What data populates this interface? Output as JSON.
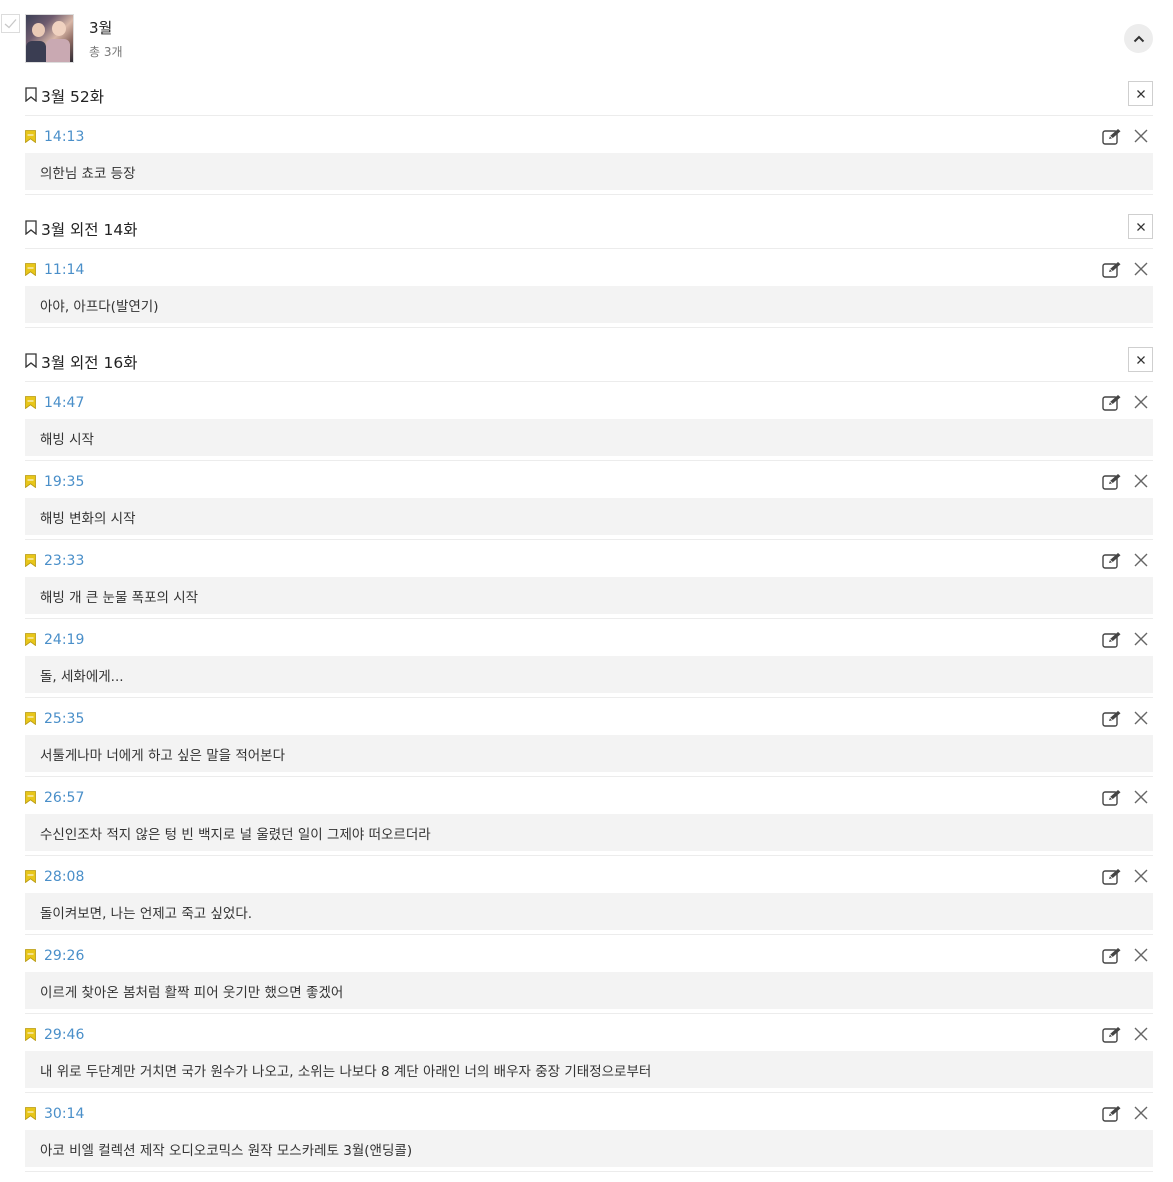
{
  "header": {
    "title": "3월",
    "count": "총 3개"
  },
  "episodes": [
    {
      "title": "3월 52화",
      "bookmarks": [
        {
          "time": "14:13",
          "note": "의한님 쵸코 등장"
        }
      ]
    },
    {
      "title": "3월 외전 14화",
      "bookmarks": [
        {
          "time": "11:14",
          "note": "아야, 아프다(발연기)"
        }
      ]
    },
    {
      "title": "3월 외전 16화",
      "bookmarks": [
        {
          "time": "14:47",
          "note": "해빙 시작"
        },
        {
          "time": "19:35",
          "note": "해빙 변화의 시작"
        },
        {
          "time": "23:33",
          "note": "해빙 개 큰 눈물 폭포의 시작"
        },
        {
          "time": "24:19",
          "note": "돌, 세화에게..."
        },
        {
          "time": "25:35",
          "note": "서툴게나마 너에게 하고 싶은 말을 적어본다"
        },
        {
          "time": "26:57",
          "note": "수신인조차 적지 않은 텅 빈 백지로 널 울렸던 일이 그제야 떠오르더라"
        },
        {
          "time": "28:08",
          "note": "돌이켜보면, 나는 언제고 죽고 싶었다."
        },
        {
          "time": "29:26",
          "note": "이르게 찾아온 봄처럼 활짝 피어 웃기만 했으면 좋겠어"
        },
        {
          "time": "29:46",
          "note": "내 위로 두단계만 거치면 국가 원수가 나오고, 소위는 나보다 8 계단 아래인 너의 배우자 중장 기태정으로부터"
        },
        {
          "time": "30:14",
          "note": "아코 비엘 컬렉션 제작 오디오코믹스 원작 모스카레토 3월(앤딩콜)"
        }
      ]
    }
  ],
  "colors": {
    "time": "#4a8fc9",
    "flag": "#e8c619",
    "note_bg": "#f3f3f3"
  },
  "icons": {
    "select": "checkmark-icon",
    "collapse": "chevron-up-icon",
    "episode": "bookmark-outline-icon",
    "bookmark": "bookmark-flag-icon",
    "edit": "edit-icon",
    "delete": "close-icon"
  }
}
